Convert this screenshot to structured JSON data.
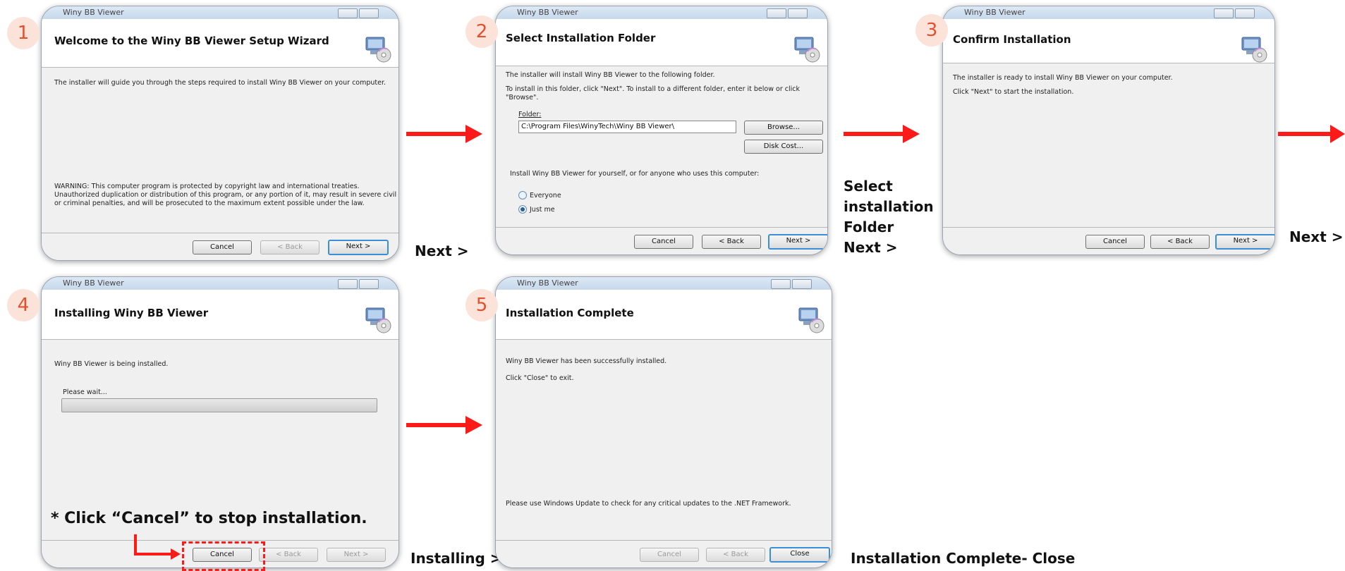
{
  "window_title": "Winy BB Viewer",
  "steps": [
    {
      "badge": "1",
      "header": "Welcome to the Winy BB Viewer Setup Wizard",
      "lines": [
        "The installer will guide you through the steps required to install Winy BB Viewer on your computer."
      ],
      "warning": [
        "WARNING: This computer program is protected by copyright law and international treaties.",
        "Unauthorized duplication or distribution of this program, or any portion of it, may result in severe civil",
        "or criminal penalties, and will be prosecuted to the maximum extent possible under the law."
      ],
      "buttons": {
        "cancel": "Cancel",
        "back": "< Back",
        "next": "Next >"
      },
      "caption": "Next >"
    },
    {
      "badge": "2",
      "header": "Select Installation Folder",
      "lines": [
        "The installer will install Winy BB Viewer to the following folder.",
        "To install in this folder, click \"Next\". To install to a different folder, enter it below or click \"Browse\"."
      ],
      "folder_label": "Folder:",
      "folder_value": "C:\\Program Files\\WinyTech\\Winy BB Viewer\\",
      "browse": "Browse...",
      "disk_cost": "Disk Cost...",
      "scope_text": "Install Winy BB Viewer for yourself, or for anyone who uses this computer:",
      "radio_everyone": "Everyone",
      "radio_justme": "Just me",
      "buttons": {
        "cancel": "Cancel",
        "back": "< Back",
        "next": "Next >"
      },
      "caption": [
        "Select",
        "installation",
        "Folder",
        "Next >"
      ]
    },
    {
      "badge": "3",
      "header": "Confirm Installation",
      "lines": [
        "The installer is ready to install Winy BB Viewer on your computer.",
        "Click \"Next\" to start the installation."
      ],
      "buttons": {
        "cancel": "Cancel",
        "back": "< Back",
        "next": "Next >"
      },
      "caption": "Next >"
    },
    {
      "badge": "4",
      "header": "Installing Winy BB Viewer",
      "lines": [
        "Winy BB Viewer is being installed."
      ],
      "please_wait": "Please wait...",
      "note": "* Click “Cancel” to stop installation.",
      "buttons": {
        "cancel": "Cancel",
        "back": "< Back",
        "next": "Next >"
      },
      "caption": "Installing >"
    },
    {
      "badge": "5",
      "header": "Installation Complete",
      "lines": [
        "Winy BB Viewer has been successfully installed.",
        "Click \"Close\" to exit."
      ],
      "update_note": "Please use Windows Update to check for any critical updates to the .NET Framework.",
      "buttons": {
        "cancel": "Cancel",
        "back": "< Back",
        "close": "Close"
      },
      "caption": "Installation Complete- Close"
    }
  ],
  "colors": {
    "arrow": "#ff1a1a",
    "badge_text": "#e2502e",
    "badge_bg": "#fbe3da",
    "highlight": "#ff1a1a"
  }
}
